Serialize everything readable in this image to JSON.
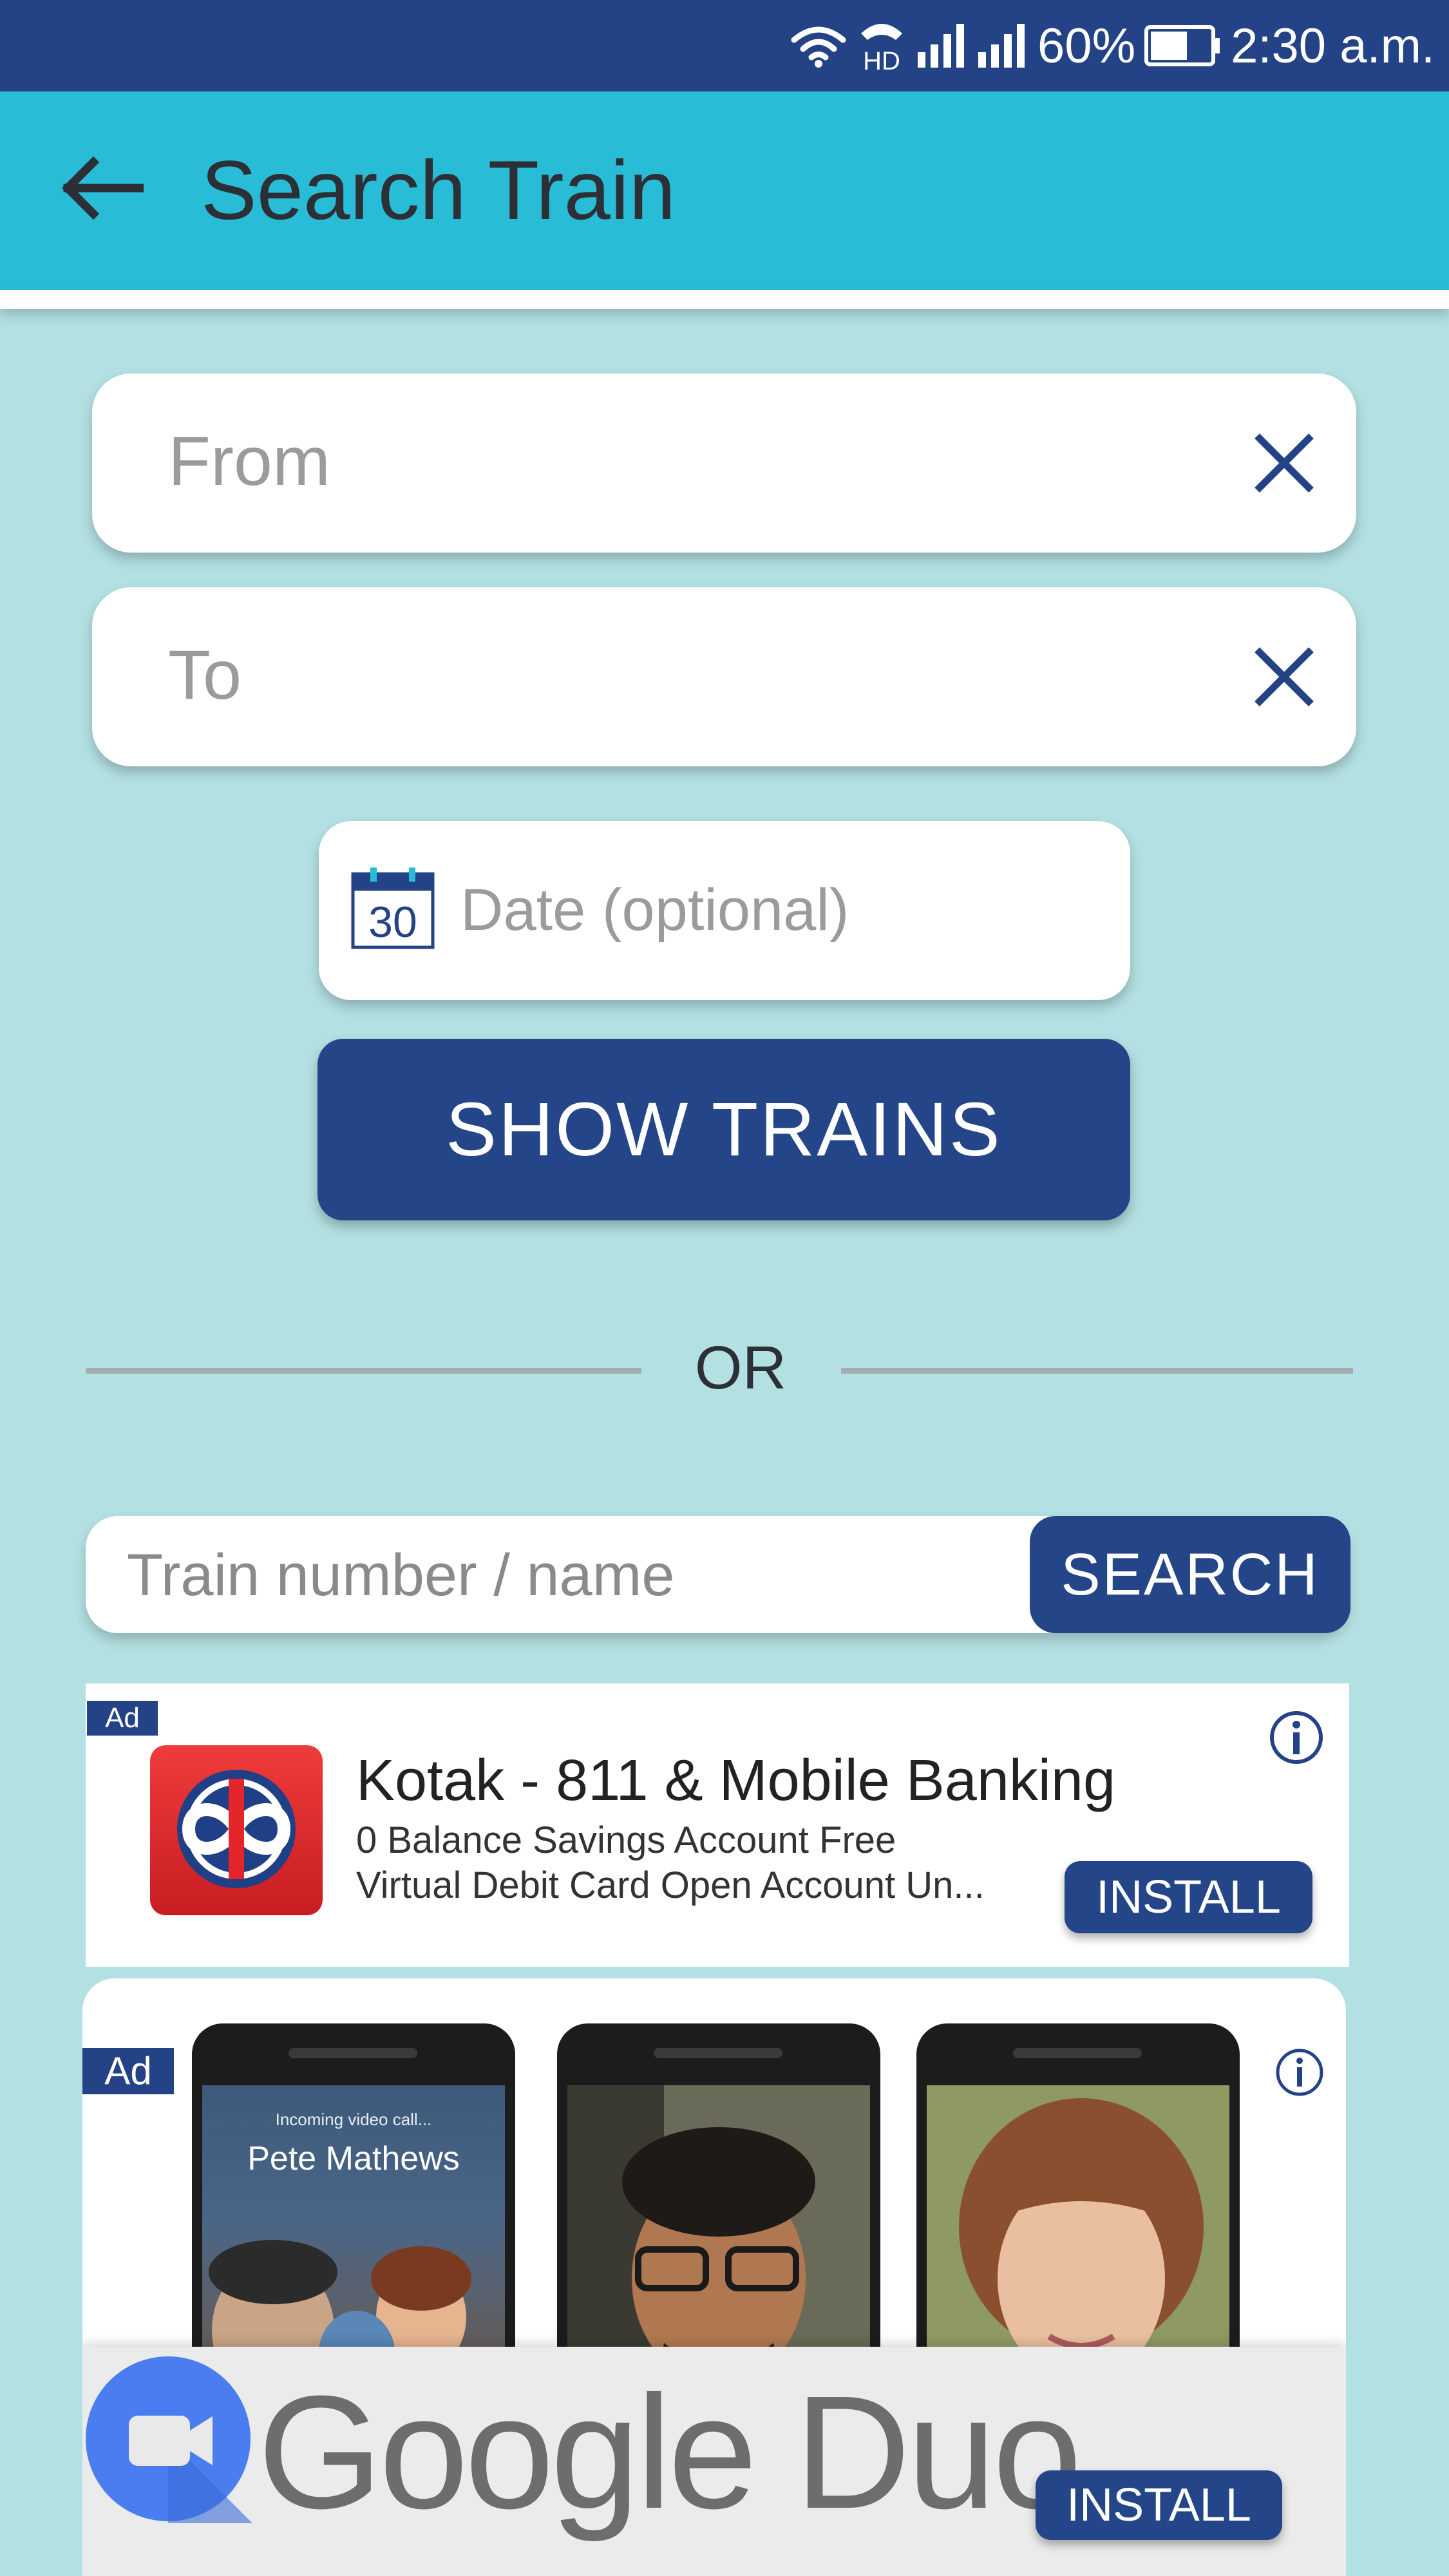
{
  "status_bar": {
    "network": "HD",
    "battery": "60%",
    "time": "2:30 a.m."
  },
  "header": {
    "title": "Search Train"
  },
  "form": {
    "from_placeholder": "From",
    "to_placeholder": "To",
    "date_icon_day": "30",
    "date_placeholder": "Date (optional)",
    "show_button": "SHOW TRAINS"
  },
  "divider": {
    "or_text": "OR"
  },
  "train_search": {
    "placeholder": "Train number / name",
    "button": "SEARCH"
  },
  "ad1": {
    "tag": "Ad",
    "title": "Kotak - 811 & Mobile Banking",
    "desc_line1": "0 Balance Savings Account Free",
    "desc_line2": "Virtual Debit Card  Open Account Un...",
    "install": "INSTALL"
  },
  "ad2": {
    "tag": "Ad",
    "call_label": "Incoming video call...",
    "caller_name": "Pete Mathews",
    "wordmark": "Google Duo",
    "install": "INSTALL"
  },
  "colors": {
    "status_bar": "#234386",
    "app_bar": "#29bcd6",
    "background": "#b3e0e2",
    "primary_button": "#244587",
    "icon_blue": "#234386"
  },
  "icons": {
    "back": "arrow-left",
    "clear": "close-x",
    "date": "calendar",
    "info": "info-circle"
  }
}
